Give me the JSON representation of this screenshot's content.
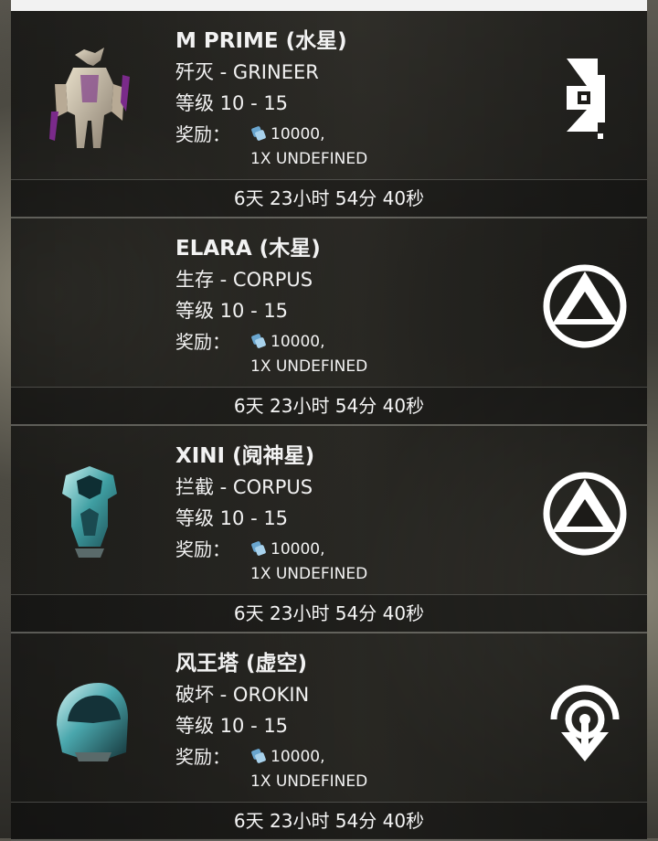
{
  "missions": [
    {
      "title": "M PRIME (水星)",
      "mission_line": "歼灭 - GRINEER",
      "level_line": "等级 10 - 15",
      "reward_label": "奖励：",
      "credits": "10000,",
      "item": "1X UNDEFINED",
      "timer": "6天 23小时 54分 40秒",
      "faction_icon": "grineer-icon",
      "thumb_icon": "warframe-helmet-thumbnail"
    },
    {
      "title": "ELARA (木星)",
      "mission_line": "生存 - CORPUS",
      "level_line": "等级 10 - 15",
      "reward_label": "奖励：",
      "credits": "10000,",
      "item": "1X UNDEFINED",
      "timer": "6天 23小时 54分 40秒",
      "faction_icon": "corpus-icon",
      "thumb_icon": "none"
    },
    {
      "title": "XINI (阋神星)",
      "mission_line": "拦截 - CORPUS",
      "level_line": "等级 10 - 15",
      "reward_label": "奖励：",
      "credits": "10000,",
      "item": "1X UNDEFINED",
      "timer": "6天 23小时 54分 40秒",
      "faction_icon": "corpus-icon",
      "thumb_icon": "helmet-thumbnail"
    },
    {
      "title": "风王塔 (虚空)",
      "mission_line": "破坏 - OROKIN",
      "level_line": "等级 10 - 15",
      "reward_label": "奖励：",
      "credits": "10000,",
      "item": "1X UNDEFINED",
      "timer": "6天 23小时 54分 40秒",
      "faction_icon": "orokin-icon",
      "thumb_icon": "helmet-thumbnail"
    }
  ],
  "colors": {
    "text": "#f2f2f2",
    "credit": "#7fb7d9",
    "card_bg": "#1c1b18"
  }
}
